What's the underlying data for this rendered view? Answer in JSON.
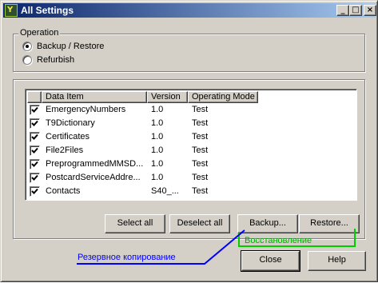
{
  "window": {
    "title": "All Settings",
    "icon_name": "app-icon",
    "controls": {
      "minimize": "_",
      "maximize": "□",
      "close": "×"
    }
  },
  "operation": {
    "label": "Operation",
    "options": [
      {
        "label": "Backup / Restore",
        "selected": true
      },
      {
        "label": "Refurbish",
        "selected": false
      }
    ]
  },
  "table": {
    "columns": [
      "Data Item",
      "Version",
      "Operating Mode"
    ],
    "rows": [
      {
        "item": "EmergencyNumbers",
        "version": "1.0",
        "mode": "Test",
        "checked": true
      },
      {
        "item": "T9Dictionary",
        "version": "1.0",
        "mode": "Test",
        "checked": true
      },
      {
        "item": "Certificates",
        "version": "1.0",
        "mode": "Test",
        "checked": true
      },
      {
        "item": "File2Files",
        "version": "1.0",
        "mode": "Test",
        "checked": true
      },
      {
        "item": "PreprogrammedMMSD...",
        "version": "1.0",
        "mode": "Test",
        "checked": true
      },
      {
        "item": "PostcardServiceAddre...",
        "version": "1.0",
        "mode": "Test",
        "checked": true
      },
      {
        "item": "Contacts",
        "version": "S40_...",
        "mode": "Test",
        "checked": true
      }
    ]
  },
  "buttons": {
    "select_all": "Select all",
    "deselect_all": "Deselect all",
    "backup": "Backup...",
    "restore": "Restore...",
    "close": "Close",
    "help": "Help"
  },
  "annotations": {
    "restore_note": "Восстановление",
    "backup_note": "Резервное копирование",
    "restore_color": "#00cc00",
    "backup_color": "#0000ff"
  },
  "colors": {
    "title_start": "#0a246a",
    "title_end": "#a6caf0",
    "face": "#d4d0c8"
  }
}
